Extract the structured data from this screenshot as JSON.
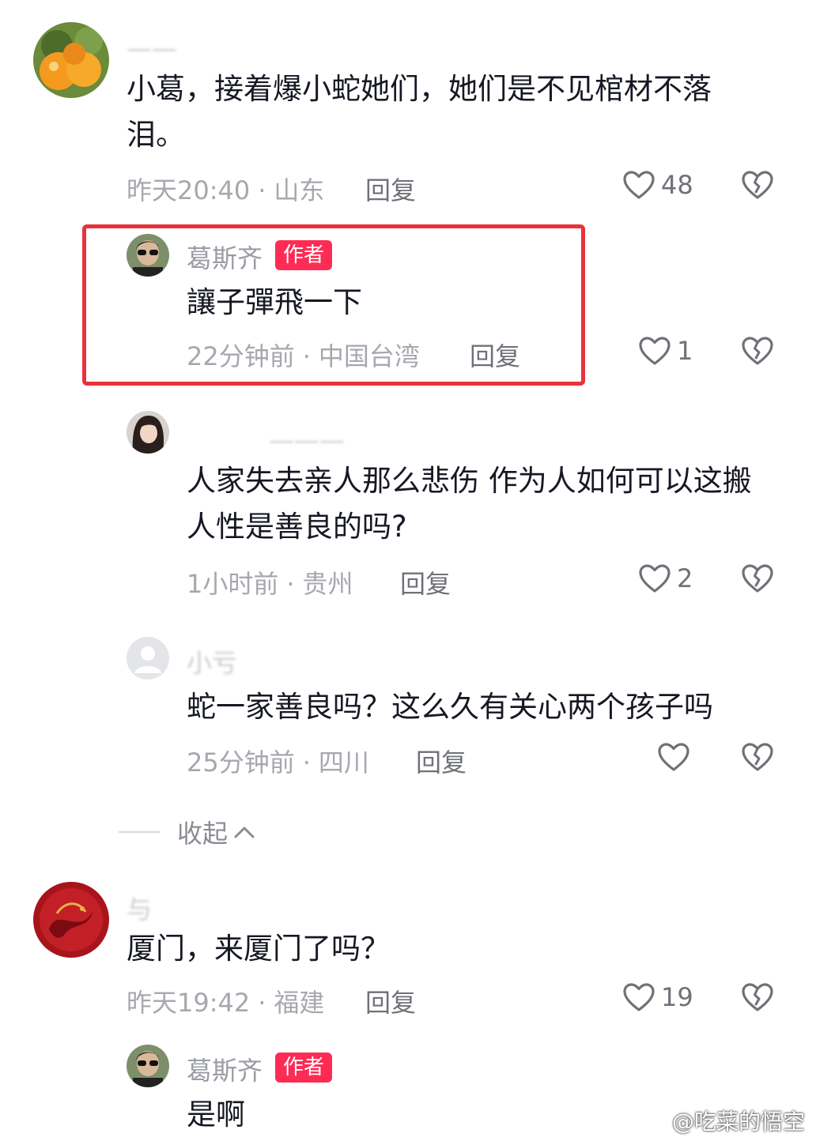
{
  "comments": [
    {
      "name": "——",
      "text": "小葛，接着爆小蛇她们，她们是不见棺材不落泪。",
      "time": "昨天20:40",
      "location": "山东",
      "reply_label": "回复",
      "likes": "48",
      "avatar": "orange-fruit-avatar"
    },
    {
      "name": "葛斯齐",
      "badge": "作者",
      "text": "讓子彈飛一下",
      "time": "22分钟前",
      "location": "中国台湾",
      "reply_label": "回复",
      "likes": "1",
      "avatar": "man-sunglasses-avatar"
    },
    {
      "name": "———",
      "text": "人家失去亲人那么悲伤 作为人如何可以这搬 人性是善良的吗?",
      "time": "1小时前",
      "location": "贵州",
      "reply_label": "回复",
      "likes": "2",
      "avatar": "woman-avatar"
    },
    {
      "name": "小亏",
      "text": "蛇一家善良吗？这么久有关心两个孩子吗",
      "time": "25分钟前",
      "location": "四川",
      "reply_label": "回复",
      "likes": "",
      "avatar": "default-user-avatar"
    },
    {
      "name": "与",
      "text": "厦门，来厦门了吗？",
      "time": "昨天19:42",
      "location": "福建",
      "reply_label": "回复",
      "likes": "19",
      "avatar": "red-dragon-avatar"
    },
    {
      "name": "葛斯齐",
      "badge": "作者",
      "text": "是啊",
      "avatar": "man-sunglasses-avatar"
    }
  ],
  "collapse_label": "收起",
  "watermark": "@吃菜的悟空",
  "colors": {
    "badge": "#fe2c55",
    "highlight": "#e8323c"
  }
}
